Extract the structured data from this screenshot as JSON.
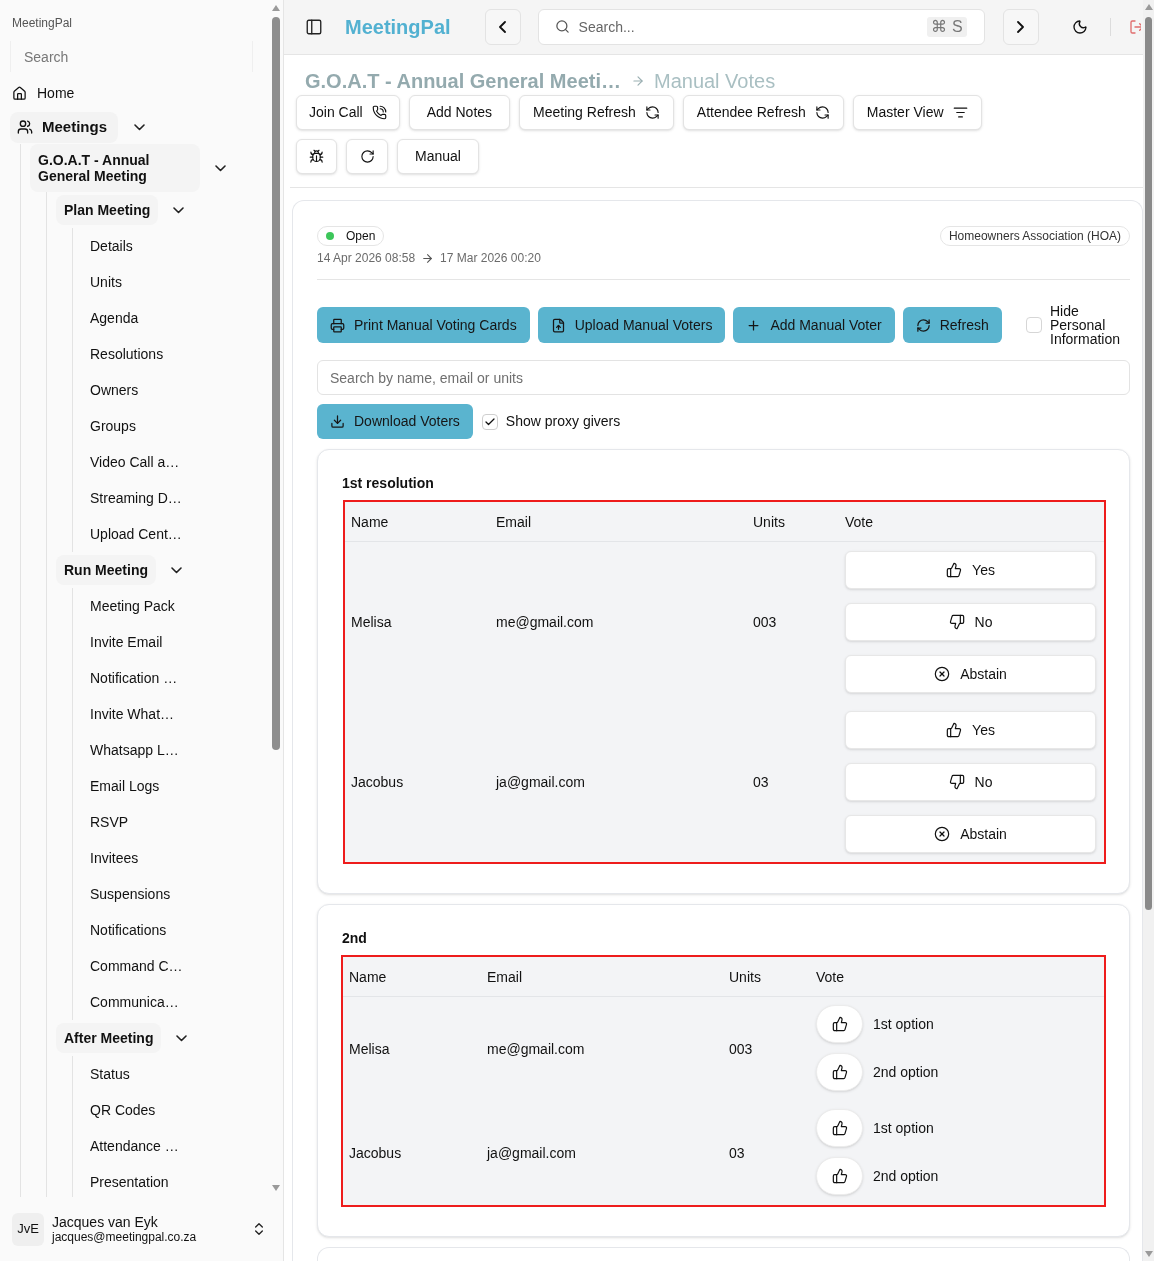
{
  "sidebar": {
    "app_name": "MeetingPal",
    "search": {
      "placeholder": "Search"
    },
    "items": [
      {
        "label": "Home"
      },
      {
        "label": "Meetings",
        "expanded": true,
        "children": [
          {
            "label": "G.O.A.T - Annual General Meeting",
            "expanded": true,
            "children": [
              {
                "label": "Plan Meeting",
                "expanded": true,
                "children": [
                  {
                    "label": "Details"
                  },
                  {
                    "label": "Units"
                  },
                  {
                    "label": "Agenda"
                  },
                  {
                    "label": "Resolutions"
                  },
                  {
                    "label": "Owners"
                  },
                  {
                    "label": "Groups"
                  },
                  {
                    "label": "Video Call a…"
                  },
                  {
                    "label": "Streaming D…"
                  },
                  {
                    "label": "Upload Cent…"
                  }
                ]
              },
              {
                "label": "Run Meeting",
                "expanded": true,
                "children": [
                  {
                    "label": "Meeting Pack"
                  },
                  {
                    "label": "Invite Email"
                  },
                  {
                    "label": "Notification …"
                  },
                  {
                    "label": "Invite What…"
                  },
                  {
                    "label": "Whatsapp L…"
                  },
                  {
                    "label": "Email Logs"
                  },
                  {
                    "label": "RSVP"
                  },
                  {
                    "label": "Invitees"
                  },
                  {
                    "label": "Suspensions"
                  },
                  {
                    "label": "Notifications"
                  },
                  {
                    "label": "Command C…"
                  },
                  {
                    "label": "Communica…"
                  }
                ]
              },
              {
                "label": "After Meeting",
                "expanded": true,
                "children": [
                  {
                    "label": "Status"
                  },
                  {
                    "label": "QR Codes"
                  },
                  {
                    "label": "Attendance …"
                  },
                  {
                    "label": "Presentation"
                  }
                ]
              }
            ]
          }
        ]
      }
    ],
    "user": {
      "initials": "JvE",
      "name": "Jacques van Eyk",
      "email": "jacques@meetingpal.co.za"
    }
  },
  "header": {
    "brand": "MeetingPal",
    "search": {
      "placeholder": "Search...",
      "shortcut": "⌘ S"
    }
  },
  "breadcrumb": [
    "G.O.A.T - Annual General Meeti…",
    "Manual Votes"
  ],
  "toolbar": {
    "buttons": [
      "Join Call",
      "Add Notes",
      "Meeting Refresh",
      "Attendee Refresh",
      "Master View"
    ],
    "secondary_buttons": [
      "Manual"
    ]
  },
  "meeting": {
    "status": "Open",
    "category": "Homeowners Association (HOA)",
    "start": "14 Apr 2026 08:58",
    "end": "17 Mar 2026 00:20",
    "actions": [
      "Print Manual Voting Cards",
      "Upload Manual Voters",
      "Add Manual Voter",
      "Refresh"
    ],
    "hide_personal_info": {
      "label": "Hide Personal Information",
      "checked": false
    },
    "search": {
      "placeholder": "Search by name, email or units"
    },
    "download": "Download Voters",
    "show_proxy_givers": {
      "label": "Show proxy givers",
      "checked": true
    }
  },
  "resolutions": [
    {
      "title": "1st resolution",
      "kind": "yes_no",
      "columns": [
        "Name",
        "Email",
        "Units",
        "Vote"
      ],
      "rows": [
        {
          "name": "Melisa",
          "email": "me@gmail.com",
          "units": "003",
          "votes": [
            "Yes",
            "No",
            "Abstain"
          ]
        },
        {
          "name": "Jacobus",
          "email": "ja@gmail.com",
          "units": "03",
          "votes": [
            "Yes",
            "No",
            "Abstain"
          ]
        }
      ]
    },
    {
      "title": "2nd",
      "kind": "options",
      "columns": [
        "Name",
        "Email",
        "Units",
        "Vote"
      ],
      "rows": [
        {
          "name": "Melisa",
          "email": "me@gmail.com",
          "units": "003",
          "votes": [
            "1st option",
            "2nd option"
          ]
        },
        {
          "name": "Jacobus",
          "email": "ja@gmail.com",
          "units": "03",
          "votes": [
            "1st option",
            "2nd option"
          ]
        }
      ]
    }
  ]
}
